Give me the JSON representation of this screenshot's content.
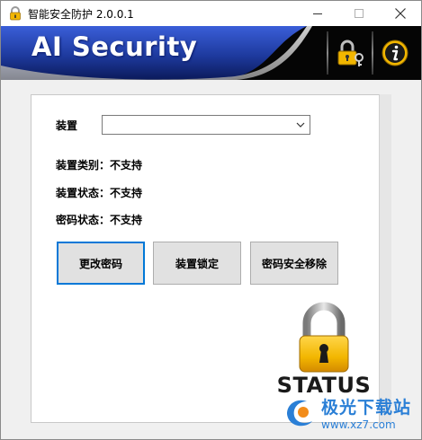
{
  "window": {
    "title": "智能安全防护 2.0.0.1",
    "minimize_icon": "minimize-icon",
    "maximize_icon": "maximize-icon",
    "close_icon": "close-icon"
  },
  "banner": {
    "title": "AI Security",
    "lock_key_icon": "lock-key-icon",
    "info_icon": "info-icon"
  },
  "device": {
    "label": "装置",
    "selected_value": ""
  },
  "info": {
    "type_label": "装置类别：不支持",
    "state_label": "装置状态：不支持",
    "password_state_label": "密码状态：不支持"
  },
  "actions": {
    "change_password": "更改密码",
    "lock_device": "装置锁定",
    "secure_remove": "密码安全移除"
  },
  "status": {
    "icon": "padlock-icon",
    "text": "STATUS"
  },
  "watermark": {
    "name": "极光下载站",
    "url": "www.xz7.com"
  },
  "colors": {
    "banner_blue": "#1e3a9e",
    "focus_blue": "#0078d7",
    "lock_gold": "#f2b600"
  }
}
